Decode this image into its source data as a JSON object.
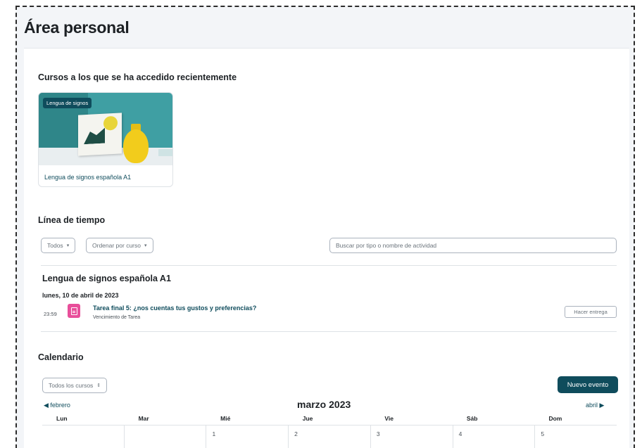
{
  "page": {
    "title": "Área personal"
  },
  "recent_courses": {
    "title": "Cursos a los que se ha accedido recientemente",
    "items": [
      {
        "category": "Lengua de signos",
        "name": "Lengua de signos española A1",
        "accent": "#0f4c5c"
      }
    ]
  },
  "timeline": {
    "title": "Línea de tiempo",
    "filter_label": "Todos",
    "sort_label": "Ordenar por curso",
    "search_placeholder": "Buscar por tipo o nombre de actividad",
    "course": "Lengua de signos española A1",
    "date": "lunes, 10 de abril de 2023",
    "event": {
      "time": "23:59",
      "title": "Tarea final 5: ¿nos cuentas tus gustos y preferencias?",
      "subtitle": "Vencimiento de Tarea",
      "action": "Hacer entrega",
      "icon": "assignment-icon",
      "icon_color": "#e84e9a"
    }
  },
  "calendar": {
    "title": "Calendario",
    "course_filter": "Todos los cursos",
    "new_event": "Nuevo evento",
    "prev_month": "febrero",
    "next_month": "abril",
    "month": "marzo 2023",
    "weekdays": [
      "Lun",
      "Mar",
      "Mié",
      "Jue",
      "Vie",
      "Sáb",
      "Dom"
    ],
    "first_week": [
      "",
      "",
      "1",
      "2",
      "3",
      "4",
      "5"
    ]
  },
  "colors": {
    "primary": "#0f4c5c",
    "page_bg": "#f3f5f8",
    "border": "#dee2e6"
  }
}
